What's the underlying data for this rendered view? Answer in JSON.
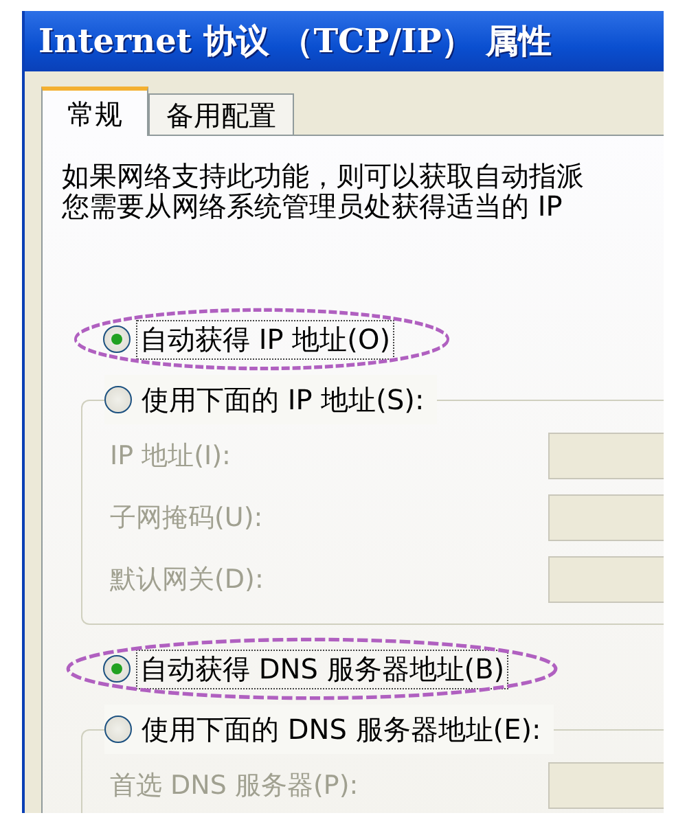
{
  "window": {
    "title": "Internet 协议 （TCP/IP） 属性"
  },
  "tabs": [
    {
      "label": "常规",
      "selected": true
    },
    {
      "label": "备用配置",
      "selected": false
    }
  ],
  "intro_lines": [
    "如果网络支持此功能，则可以获取自动指派",
    "您需要从网络系统管理员处获得适当的 IP"
  ],
  "groups": [
    {
      "auto_option": {
        "label": "自动获得 IP 地址(O)",
        "selected": true,
        "highlighted": true
      },
      "manual_option": {
        "label": "使用下面的 IP 地址(S):",
        "selected": false
      },
      "fields": [
        {
          "label": "IP 地址(I):",
          "disabled": true
        },
        {
          "label": "子网掩码(U):",
          "disabled": true
        },
        {
          "label": "默认网关(D):",
          "disabled": true
        }
      ]
    },
    {
      "auto_option": {
        "label": "自动获得 DNS 服务器地址(B)",
        "selected": true,
        "highlighted": true
      },
      "manual_option": {
        "label": "使用下面的 DNS 服务器地址(E):",
        "selected": false
      },
      "fields": [
        {
          "label": "首选 DNS 服务器(P):",
          "disabled": true
        }
      ]
    }
  ]
}
